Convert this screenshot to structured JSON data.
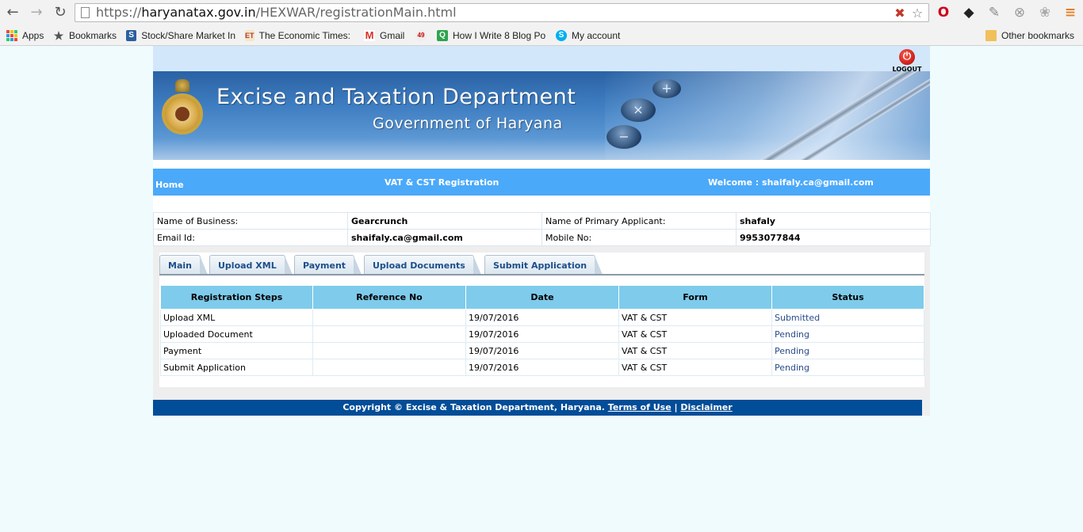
{
  "browser": {
    "url_prefix": "https://",
    "url_host": "haryanatax.gov.in",
    "url_path": "/HEXWAR/registrationMain.html",
    "back_icon": "←",
    "forward_icon": "→",
    "reload_icon": "↻",
    "star_icon": "☆",
    "menu_icon": "≡",
    "bookmarks": [
      {
        "label": "Apps"
      },
      {
        "label": "Bookmarks"
      },
      {
        "label": "Stock/Share Market In"
      },
      {
        "label": "The Economic Times:"
      },
      {
        "label": "Gmail"
      },
      {
        "label": ""
      },
      {
        "label": "How I Write 8 Blog Po"
      },
      {
        "label": "My account"
      }
    ],
    "other_bookmarks": "Other bookmarks"
  },
  "header": {
    "logout_label": "LOGOUT",
    "title": "Excise and Taxation Department",
    "subtitle": "Government of Haryana"
  },
  "navbar": {
    "home": "Home",
    "center": "VAT & CST Registration",
    "welcome": "Welcome : shaifaly.ca@gmail.com"
  },
  "info": {
    "business_label": "Name of Business:",
    "business_value": "Gearcrunch",
    "applicant_label": "Name of Primary Applicant:",
    "applicant_value": "shafaly",
    "email_label": "Email Id:",
    "email_value": "shaifaly.ca@gmail.com",
    "mobile_label": "Mobile No:",
    "mobile_value": "9953077844"
  },
  "tabs": [
    "Main",
    "Upload XML",
    "Payment",
    "Upload Documents",
    "Submit Application"
  ],
  "steps": {
    "headers": [
      "Registration Steps",
      "Reference No",
      "Date",
      "Form",
      "Status"
    ],
    "rows": [
      {
        "step": "Upload XML",
        "ref": "",
        "date": "19/07/2016",
        "form": "VAT & CST",
        "status": "Submitted"
      },
      {
        "step": "Uploaded Document",
        "ref": "",
        "date": "19/07/2016",
        "form": "VAT & CST",
        "status": "Pending"
      },
      {
        "step": "Payment",
        "ref": "",
        "date": "19/07/2016",
        "form": "VAT & CST",
        "status": "Pending"
      },
      {
        "step": "Submit Application",
        "ref": "",
        "date": "19/07/2016",
        "form": "VAT & CST",
        "status": "Pending"
      }
    ]
  },
  "footer": {
    "copyright": "Copyright © Excise & Taxation Department, Haryana.",
    "terms": "Terms of Use",
    "sep": "|",
    "disclaimer": "Disclaimer"
  }
}
